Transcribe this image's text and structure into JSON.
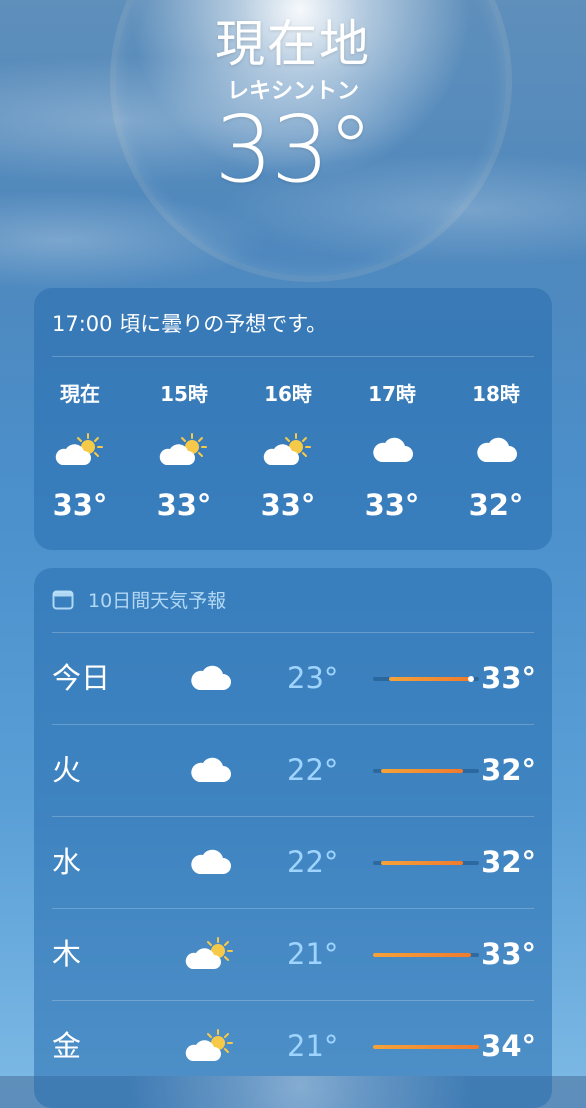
{
  "location": {
    "title": "現在地",
    "subtitle": "レキシントン",
    "current_temp": "33°"
  },
  "hourly": {
    "summary": "17:00 頃に曇りの予想です。",
    "items": [
      {
        "label": "現在",
        "icon": "partly-cloudy-sun-icon",
        "temp": "33°"
      },
      {
        "label": "15時",
        "icon": "partly-cloudy-sun-icon",
        "temp": "33°"
      },
      {
        "label": "16時",
        "icon": "partly-cloudy-sun-icon",
        "temp": "33°"
      },
      {
        "label": "17時",
        "icon": "cloud-icon",
        "temp": "33°"
      },
      {
        "label": "18時",
        "icon": "cloud-icon",
        "temp": "32°"
      }
    ]
  },
  "daily": {
    "heading": "10日間天気予報",
    "heading_icon": "calendar-icon",
    "range": {
      "min": 21,
      "max": 34
    },
    "items": [
      {
        "day": "今日",
        "icon": "cloud-icon",
        "low": "23°",
        "high": "33°",
        "low_value": 23,
        "high_value": 33,
        "current_value": 33
      },
      {
        "day": "火",
        "icon": "cloud-icon",
        "low": "22°",
        "high": "32°",
        "low_value": 22,
        "high_value": 32
      },
      {
        "day": "水",
        "icon": "cloud-icon",
        "low": "22°",
        "high": "32°",
        "low_value": 22,
        "high_value": 32
      },
      {
        "day": "木",
        "icon": "partly-cloudy-sun-icon",
        "low": "21°",
        "high": "33°",
        "low_value": 21,
        "high_value": 33
      },
      {
        "day": "金",
        "icon": "partly-cloudy-sun-icon",
        "low": "21°",
        "high": "34°",
        "low_value": 21,
        "high_value": 34
      }
    ]
  },
  "colors": {
    "bar_start": "#f5a33a",
    "bar_end": "#f07a2e",
    "low_temp": "#9fd4ff",
    "sun": "#f7c948"
  }
}
